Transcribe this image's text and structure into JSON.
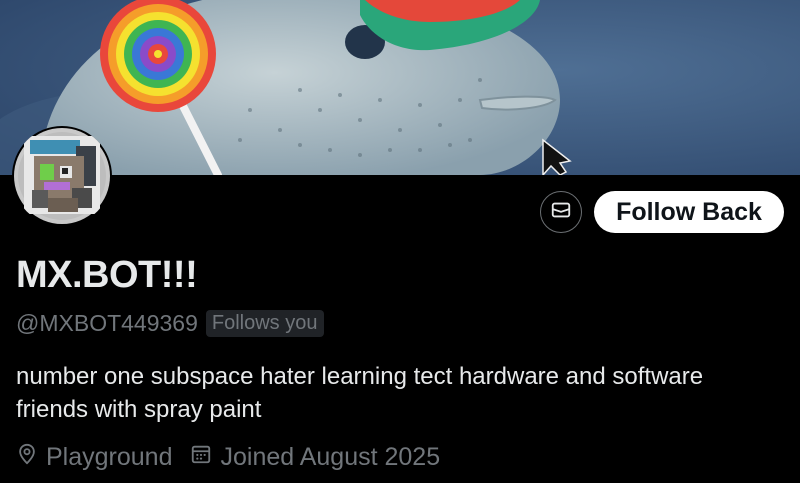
{
  "profile": {
    "name": "MX.BOT!!!",
    "handle": "@MXBOT449369",
    "follows_you_badge": "Follows you",
    "bio": "number one subspace hater learning tect hardware and software friends with spray paint",
    "location": "Playground",
    "joined": "Joined August 2025"
  },
  "actions": {
    "message_icon": "envelope-icon",
    "follow_label": "Follow Back"
  },
  "icons": {
    "location": "map-pin-icon",
    "joined": "calendar-icon"
  },
  "colors": {
    "background": "#000000",
    "text_primary": "#e7e9ea",
    "text_secondary": "#71767b",
    "follow_button_bg": "#ffffff",
    "follow_button_text": "#0f1419"
  }
}
